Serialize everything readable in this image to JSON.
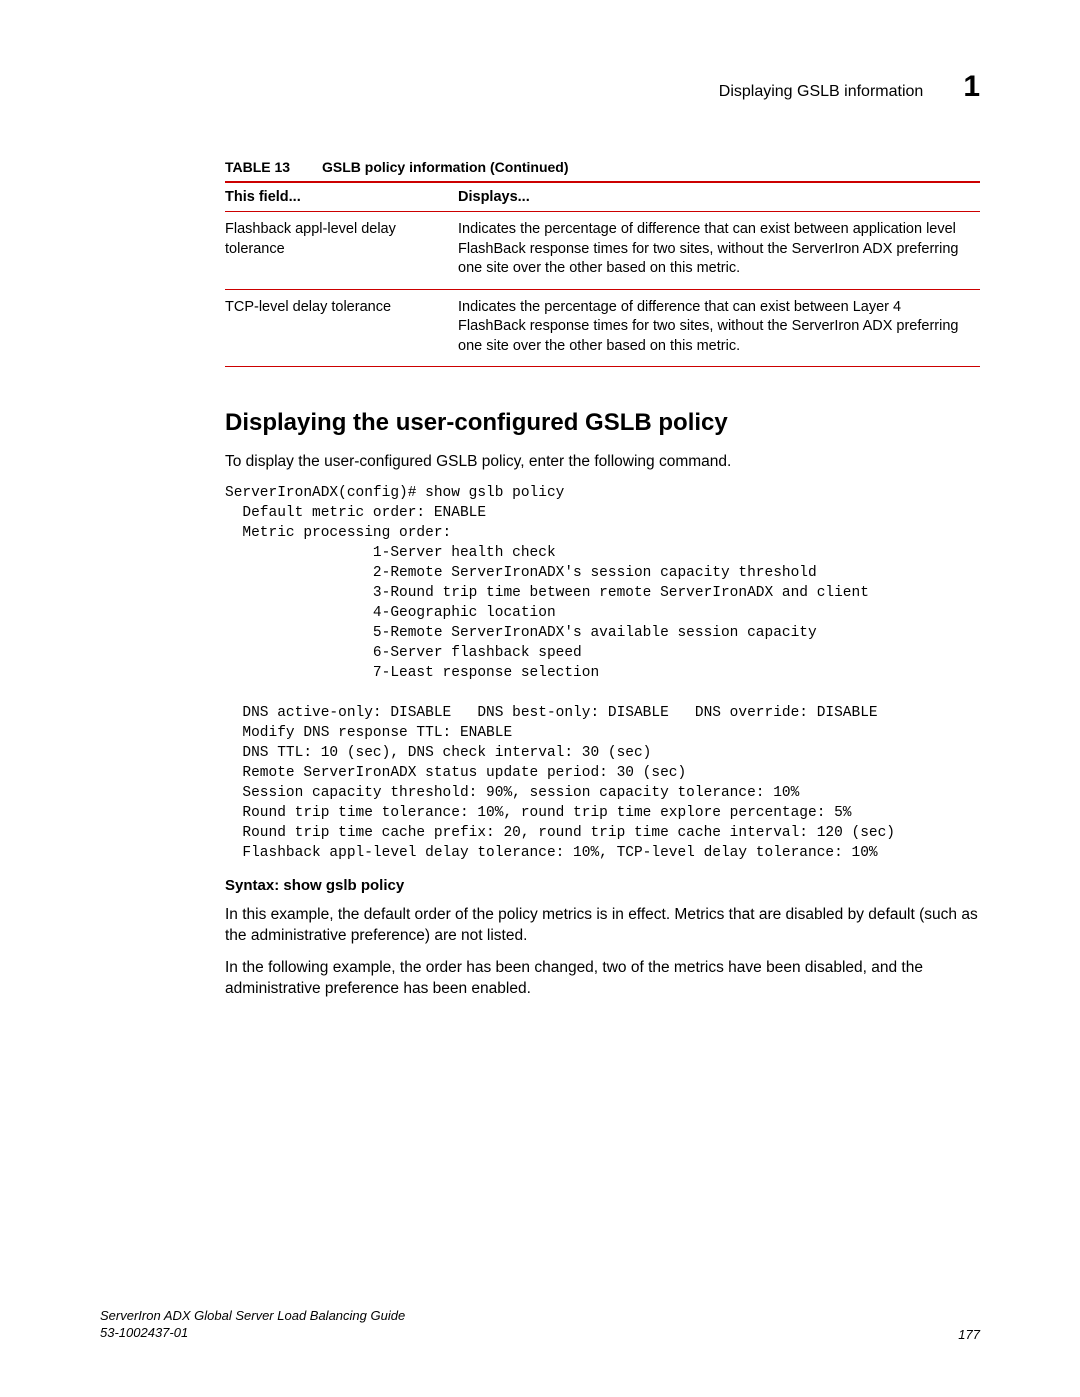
{
  "header": {
    "runhead": "Displaying GSLB information",
    "chapnum": "1"
  },
  "table": {
    "label": "TABLE 13",
    "title": "GSLB policy information (Continued)",
    "col1": "This field...",
    "col2": "Displays...",
    "rows": [
      {
        "field": "Flashback appl-level delay tolerance",
        "displays": "Indicates the percentage of difference that can exist between application level FlashBack response times for two sites, without the ServerIron ADX preferring one site over the other based on this metric."
      },
      {
        "field": "TCP-level delay tolerance",
        "displays": "Indicates the percentage of difference that can exist between Layer 4 FlashBack response times for two sites, without the ServerIron ADX preferring one site over the other based on this metric."
      }
    ]
  },
  "section_title": "Displaying the user-configured GSLB policy",
  "intro": "To display the user-configured GSLB policy, enter the following command.",
  "cli": "ServerIronADX(config)# show gslb policy\n  Default metric order: ENABLE\n  Metric processing order:\n                 1-Server health check\n                 2-Remote ServerIronADX's session capacity threshold\n                 3-Round trip time between remote ServerIronADX and client\n                 4-Geographic location\n                 5-Remote ServerIronADX's available session capacity\n                 6-Server flashback speed\n                 7-Least response selection\n\n  DNS active-only: DISABLE   DNS best-only: DISABLE   DNS override: DISABLE\n  Modify DNS response TTL: ENABLE\n  DNS TTL: 10 (sec), DNS check interval: 30 (sec)\n  Remote ServerIronADX status update period: 30 (sec)\n  Session capacity threshold: 90%, session capacity tolerance: 10%\n  Round trip time tolerance: 10%, round trip time explore percentage: 5%\n  Round trip time cache prefix: 20, round trip time cache interval: 120 (sec)\n  Flashback appl-level delay tolerance: 10%, TCP-level delay tolerance: 10%",
  "syntax": "Syntax:  show gslb policy",
  "para1": "In this example, the default order of the policy metrics is in effect. Metrics that are disabled by default (such as the administrative preference) are not listed.",
  "para2": "In the following example, the order has been changed, two of the metrics have been disabled, and the administrative preference has been enabled.",
  "footer": {
    "title": "ServerIron ADX Global Server Load Balancing Guide",
    "docnum": "53-1002437-01",
    "page": "177"
  }
}
